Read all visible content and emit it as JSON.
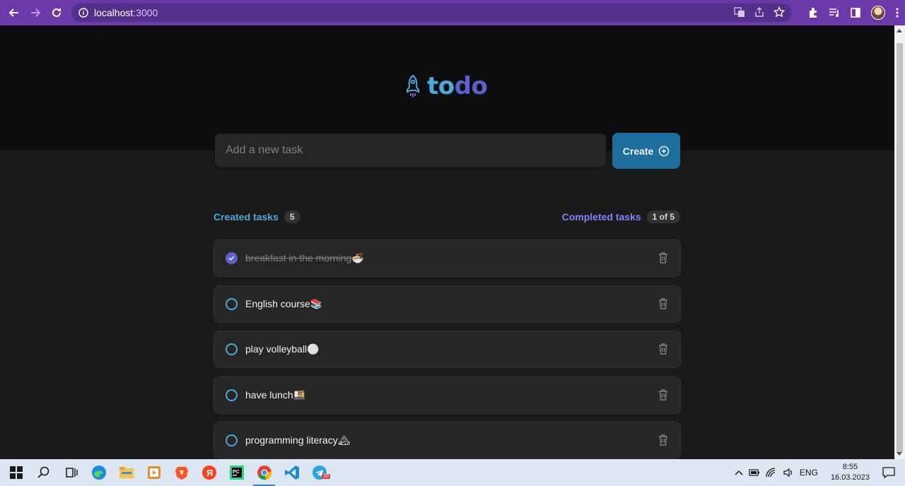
{
  "browser": {
    "url_host": "localhost",
    "url_port": ":3000"
  },
  "app": {
    "logo_icon": "rocket-icon",
    "logo_part1": "to",
    "logo_part2": "do",
    "input_placeholder": "Add a new task",
    "create_label": "Create",
    "created_label": "Created tasks",
    "created_count": "5",
    "completed_label": "Completed tasks",
    "completed_count": "1 of 5",
    "tasks": [
      {
        "text": "breakfast in the morning🍜",
        "done": true
      },
      {
        "text": "English course📚",
        "done": false
      },
      {
        "text": "play volleyball⚪",
        "done": false
      },
      {
        "text": "have lunch🍱",
        "done": false
      },
      {
        "text": "programming literacy🏔",
        "done": false
      }
    ]
  },
  "taskbar": {
    "lang": "ENG",
    "time": "8:55",
    "date": "16.03.2023",
    "telegram_badge": "20"
  },
  "colors": {
    "blue": "#4ea8de",
    "purple": "#5e60ce",
    "purple_light": "#8284fa",
    "dark_blue": "#1e6f9f"
  }
}
